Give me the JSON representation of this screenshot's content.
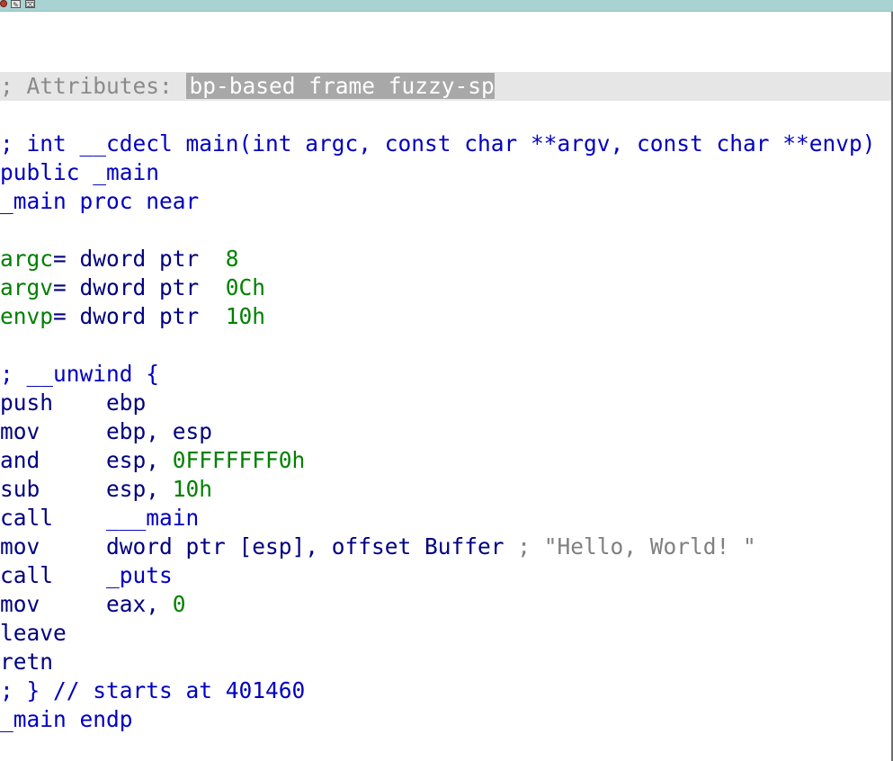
{
  "attributes": {
    "prefix": "; Attributes: ",
    "value": "bp-based frame fuzzy-sp"
  },
  "header": {
    "signature": "; int __cdecl main(int argc, const char **argv, const char **envp)",
    "public": "public _main",
    "proc": "_main proc near"
  },
  "vars": [
    {
      "name": "argc",
      "decl": "= dword ptr  ",
      "value": "8"
    },
    {
      "name": "argv",
      "decl": "= dword ptr  ",
      "value": "0Ch"
    },
    {
      "name": "envp",
      "decl": "= dword ptr  ",
      "value": "10h"
    }
  ],
  "code": {
    "unwind": "; __unwind {",
    "instructions": [
      {
        "mnemonic": "push    ",
        "operand": "ebp",
        "imm": "",
        "comment": ""
      },
      {
        "mnemonic": "mov     ",
        "operand": "ebp, esp",
        "imm": "",
        "comment": ""
      },
      {
        "mnemonic": "and     ",
        "operand": "esp, ",
        "imm": "0FFFFFFF0h",
        "comment": ""
      },
      {
        "mnemonic": "sub     ",
        "operand": "esp, ",
        "imm": "10h",
        "comment": ""
      },
      {
        "mnemonic": "call    ",
        "operand": "___main",
        "imm": "",
        "comment": ""
      },
      {
        "mnemonic": "mov     ",
        "operand": "dword ptr [esp], offset Buffer ",
        "imm": "",
        "comment": "; \"Hello, World! \""
      },
      {
        "mnemonic": "call    ",
        "operand": "_puts",
        "imm": "",
        "comment": ""
      },
      {
        "mnemonic": "mov     ",
        "operand": "eax, ",
        "imm": "0",
        "comment": ""
      },
      {
        "mnemonic": "leave",
        "operand": "",
        "imm": "",
        "comment": ""
      },
      {
        "mnemonic": "retn",
        "operand": "",
        "imm": "",
        "comment": ""
      }
    ],
    "unwind_end": "; } // starts at 401460",
    "endp": "_main endp"
  }
}
